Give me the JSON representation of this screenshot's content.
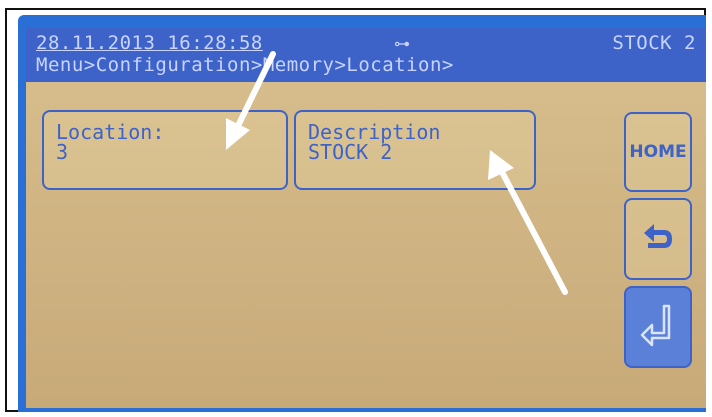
{
  "status_bar": {
    "datetime": "28.11.2013 16:28:58",
    "location_name": "STOCK 2",
    "breadcrumb": "Menu>Configuration>Memory>Location>"
  },
  "fields": {
    "location": {
      "label": "Location:",
      "value": "3"
    },
    "description": {
      "label": "Description",
      "value": "STOCK 2"
    }
  },
  "side_buttons": {
    "home_label": "HOME",
    "back_icon": "back-arrow-icon",
    "enter_icon": "enter-return-icon"
  },
  "colors": {
    "bezel": "#2a6fd6",
    "lcd_background": "#d2b886",
    "lcd_text": "#3d63c9",
    "annotation_arrows": "#ffffff"
  }
}
